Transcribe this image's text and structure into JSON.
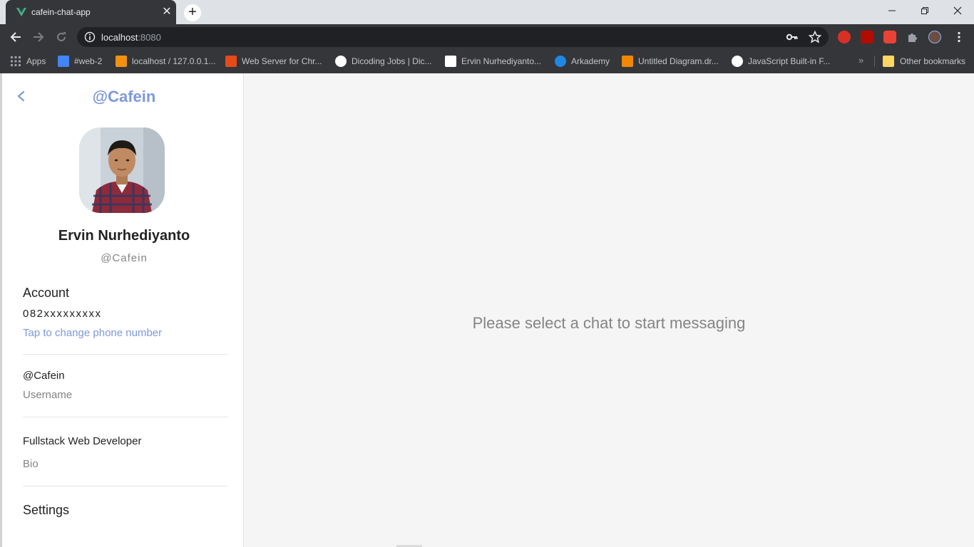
{
  "browser": {
    "tab_title": "cafein-chat-app",
    "url_host": "localhost",
    "url_port": ":8080",
    "colors": {
      "tab_bg": "#35363a",
      "frame": "#dee1e6",
      "omnibox_bg": "#202124"
    },
    "icons": [
      "back-icon",
      "forward-icon",
      "reload-icon",
      "info-icon",
      "key-icon",
      "star-icon",
      "extensions-icon",
      "menu-icon"
    ]
  },
  "bookmarks": [
    {
      "label": "Apps",
      "color": "#9aa0a6"
    },
    {
      "label": "#web-2",
      "color": "#4285f4"
    },
    {
      "label": "localhost / 127.0.0.1...",
      "color": "#f29111"
    },
    {
      "label": "Web Server for Chr...",
      "color": "#e64a19"
    },
    {
      "label": "Dicoding Jobs | Dic...",
      "color": "#ffffff"
    },
    {
      "label": "Ervin Nurhediyanto...",
      "color": "#ffffff"
    },
    {
      "label": "Arkademy",
      "color": "#1e88e5"
    },
    {
      "label": "Untitled Diagram.dr...",
      "color": "#f08705"
    },
    {
      "label": "JavaScript Built-in F...",
      "color": "#ffffff"
    }
  ],
  "bookmarks_more": "»",
  "other_bookmarks": "Other bookmarks",
  "sidebar": {
    "title": "@Cafein",
    "full_name": "Ervin Nurhediyanto",
    "handle": "@Cafein",
    "account_heading": "Account",
    "phone": "082xxxxxxxxx",
    "change_phone_link": "Tap to change phone number",
    "username_value": "@Cafein",
    "username_label": "Username",
    "bio_value": "Fullstack Web Developer",
    "bio_label": "Bio",
    "settings": "Settings",
    "accent": "#7e98df"
  },
  "chat": {
    "empty_message": "Please select a chat to start messaging"
  }
}
